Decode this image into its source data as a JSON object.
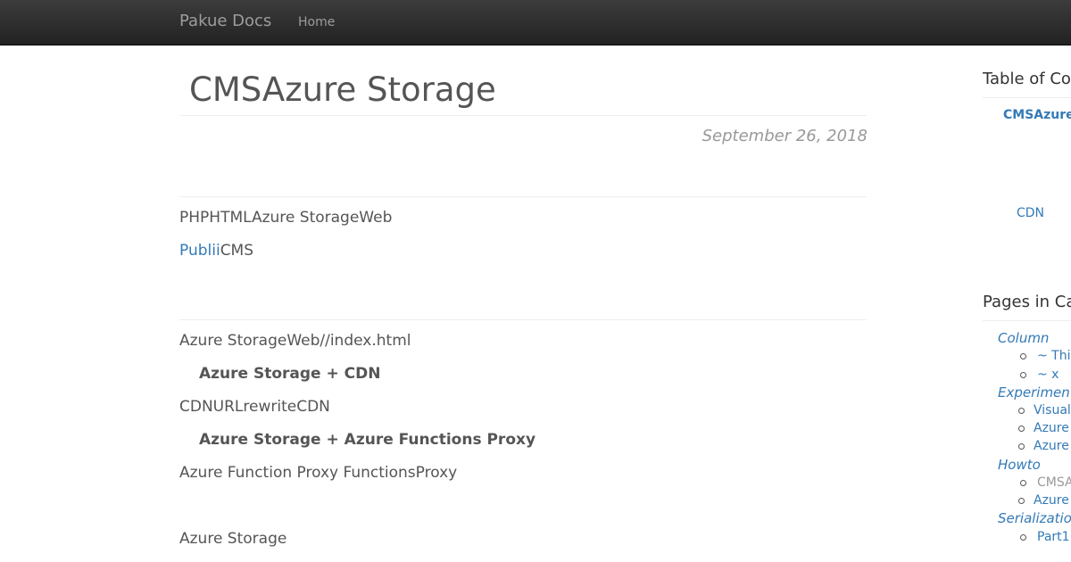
{
  "navbar": {
    "brand": "Pakue Docs",
    "home": "Home"
  },
  "article": {
    "title": "CMSAzure Storage",
    "date": "September 26, 2018",
    "p1": "PHPHTMLAzure StorageWeb",
    "p2_link": "Publii",
    "p2_rest": "CMS",
    "p3": "Azure StorageWeb//index.html",
    "h1": "Azure Storage + CDN",
    "p4": "CDNURLrewriteCDN",
    "h2": "Azure Storage + Azure Functions Proxy",
    "p5": "Azure Function Proxy FunctionsProxy",
    "p6": "Azure Storage"
  },
  "sidebar": {
    "toc_heading": "Table of Co",
    "toc_items": [
      "CMSAzure",
      "CDN"
    ],
    "pages_heading": "Pages in Ca",
    "categories": [
      {
        "name": "Column",
        "items": [
          "~ Thi",
          "~ x"
        ]
      },
      {
        "name": "Experimen",
        "items": [
          "Visual",
          "Azure",
          "Azure"
        ]
      },
      {
        "name": "Howto",
        "items": [
          "CMSA",
          "Azure"
        ]
      },
      {
        "name": "Serializatio",
        "items": [
          "Part1"
        ]
      }
    ]
  },
  "colors": {
    "link": "#337ab7",
    "text": "#555555",
    "navbar": "#222222",
    "muted": "#999999"
  }
}
